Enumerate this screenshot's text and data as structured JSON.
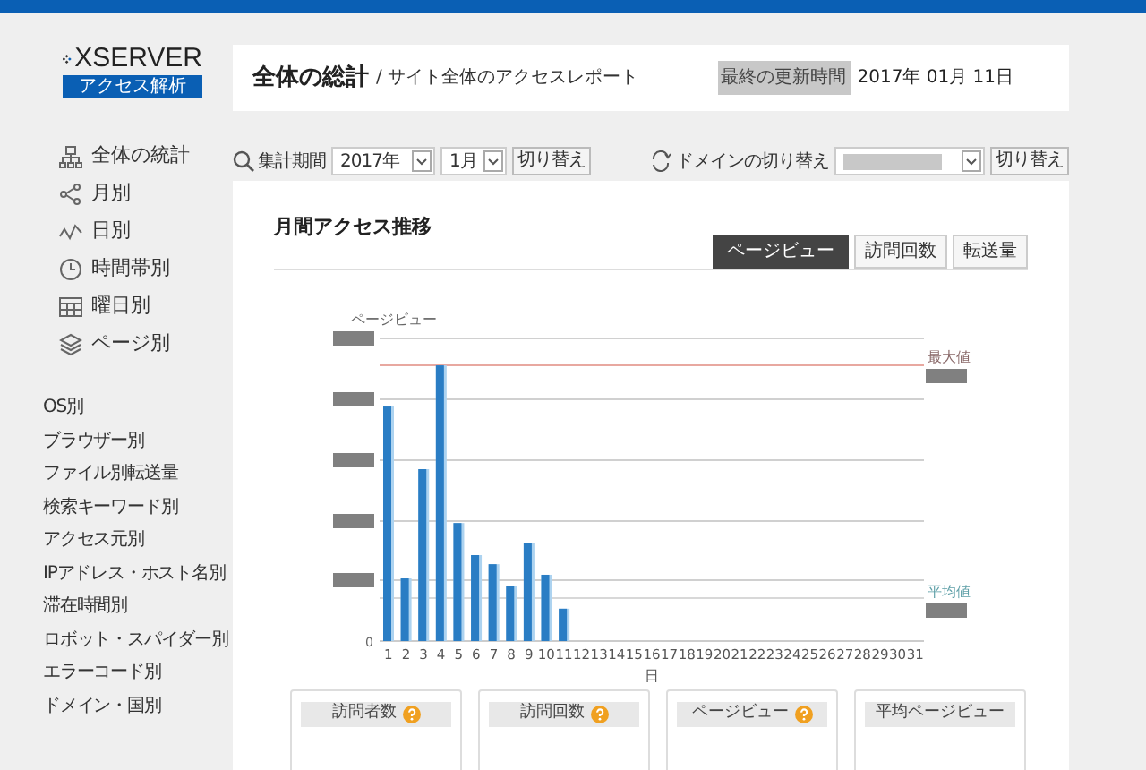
{
  "logo": {
    "name": "XSERVER",
    "sub": "アクセス解析"
  },
  "header": {
    "title": "全体の総計",
    "subtitle": "/ サイト全体のアクセスレポート",
    "updated_label": "最終の更新時間",
    "updated_value": "2017年 01月 11日"
  },
  "sidebar": {
    "main_items": [
      {
        "label": "全体の統計",
        "kind": "sitemap"
      },
      {
        "label": "月別",
        "kind": "share"
      },
      {
        "label": "日別",
        "kind": "wave"
      },
      {
        "label": "時間帯別",
        "kind": "clock"
      },
      {
        "label": "曜日別",
        "kind": "calendar"
      },
      {
        "label": "ページ別",
        "kind": "layers"
      }
    ],
    "sub_items": [
      "OS別",
      "ブラウザー別",
      "ファイル別転送量",
      "検索キーワード別",
      "アクセス元別",
      "IPアドレス・ホスト名別",
      "滞在時間別",
      "ロボット・スパイダー別",
      "エラーコード別",
      "ドメイン・国別"
    ]
  },
  "period": {
    "label": "集計期間",
    "year": "2017年",
    "month": "1月",
    "button": "切り替え"
  },
  "domain": {
    "label": "ドメインの切り替え",
    "button": "切り替え"
  },
  "panel": {
    "title": "月間アクセス推移",
    "tabs": [
      {
        "label": "ページビュー",
        "selected": true
      },
      {
        "label": "訪問回数",
        "selected": false
      },
      {
        "label": "転送量",
        "selected": false
      }
    ],
    "chart": {
      "y_title": "ページビュー",
      "zero": "0",
      "max_label": "最大値",
      "avg_label": "平均値",
      "x_title": "日",
      "x_labels": [
        "1",
        "2",
        "3",
        "4",
        "5",
        "6",
        "7",
        "8",
        "9",
        "10",
        "11",
        "12",
        "13",
        "14",
        "15",
        "16",
        "17",
        "18",
        "19",
        "20",
        "21",
        "22",
        "23",
        "24",
        "25",
        "26",
        "27",
        "28",
        "29",
        "30",
        "31"
      ]
    }
  },
  "stat_cards": [
    {
      "label": "訪問者数",
      "help": true
    },
    {
      "label": "訪問回数",
      "help": true
    },
    {
      "label": "ページビュー",
      "help": true
    },
    {
      "label": "平均ページビュー",
      "help": false
    }
  ]
}
